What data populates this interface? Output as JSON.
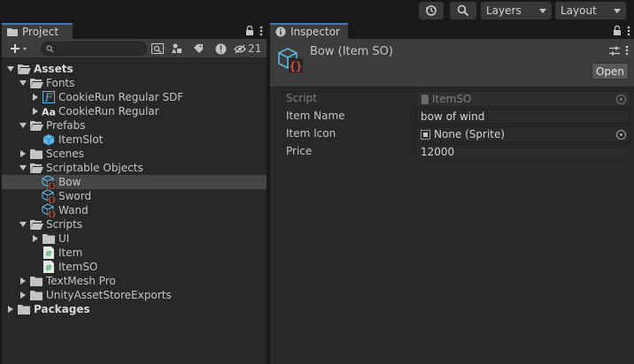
{
  "topbar": {
    "layers_label": "Layers",
    "layout_label": "Layout"
  },
  "project": {
    "tab_label": "Project",
    "hidden_count": "21",
    "tree": [
      {
        "label": "Assets",
        "icon": "folder-open-icon",
        "depth": 0,
        "expanded": true,
        "bold": true
      },
      {
        "label": "Fonts",
        "icon": "folder-open-icon",
        "depth": 1,
        "expanded": true
      },
      {
        "label": "CookieRun Regular SDF",
        "icon": "font-asset-icon",
        "depth": 2,
        "expanded": false
      },
      {
        "label": "CookieRun Regular",
        "icon": "font-icon",
        "depth": 2,
        "expanded": false
      },
      {
        "label": "Prefabs",
        "icon": "folder-open-icon",
        "depth": 1,
        "expanded": true
      },
      {
        "label": "ItemSlot",
        "icon": "prefab-icon",
        "depth": 2
      },
      {
        "label": "Scenes",
        "icon": "folder-icon",
        "depth": 1,
        "expanded": false
      },
      {
        "label": "Scriptable Objects",
        "icon": "folder-open-icon",
        "depth": 1,
        "expanded": true
      },
      {
        "label": "Bow",
        "icon": "scriptable-object-icon",
        "depth": 2,
        "selected": true
      },
      {
        "label": "Sword",
        "icon": "scriptable-object-icon",
        "depth": 2
      },
      {
        "label": "Wand",
        "icon": "scriptable-object-icon",
        "depth": 2
      },
      {
        "label": "Scripts",
        "icon": "folder-open-icon",
        "depth": 1,
        "expanded": true
      },
      {
        "label": "UI",
        "icon": "folder-icon",
        "depth": 2,
        "expanded": false
      },
      {
        "label": "Item",
        "icon": "csharp-script-icon",
        "depth": 2
      },
      {
        "label": "ItemSO",
        "icon": "csharp-script-icon",
        "depth": 2
      },
      {
        "label": "TextMesh Pro",
        "icon": "folder-icon",
        "depth": 1,
        "expanded": false
      },
      {
        "label": "UnityAssetStoreExports",
        "icon": "folder-icon",
        "depth": 1,
        "expanded": false
      },
      {
        "label": "Packages",
        "icon": "folder-icon",
        "depth": 0,
        "expanded": false,
        "bold": true
      }
    ]
  },
  "inspector": {
    "tab_label": "Inspector",
    "title": "Bow (Item SO)",
    "open_label": "Open",
    "fields": {
      "script": {
        "label": "Script",
        "value": "ItemSO"
      },
      "item_name": {
        "label": "Item Name",
        "value": "bow of wind"
      },
      "item_icon": {
        "label": "Item Icon",
        "value": "None (Sprite)"
      },
      "price": {
        "label": "Price",
        "value": "12000"
      }
    }
  },
  "colors": {
    "accent": "#3a79bb",
    "panel_bg": "#282828",
    "header_bg": "#3c3c3c",
    "selection": "#454545",
    "script_green": "#3fb96c",
    "so_red": "#e2513b",
    "so_blue": "#5bb7e6"
  }
}
